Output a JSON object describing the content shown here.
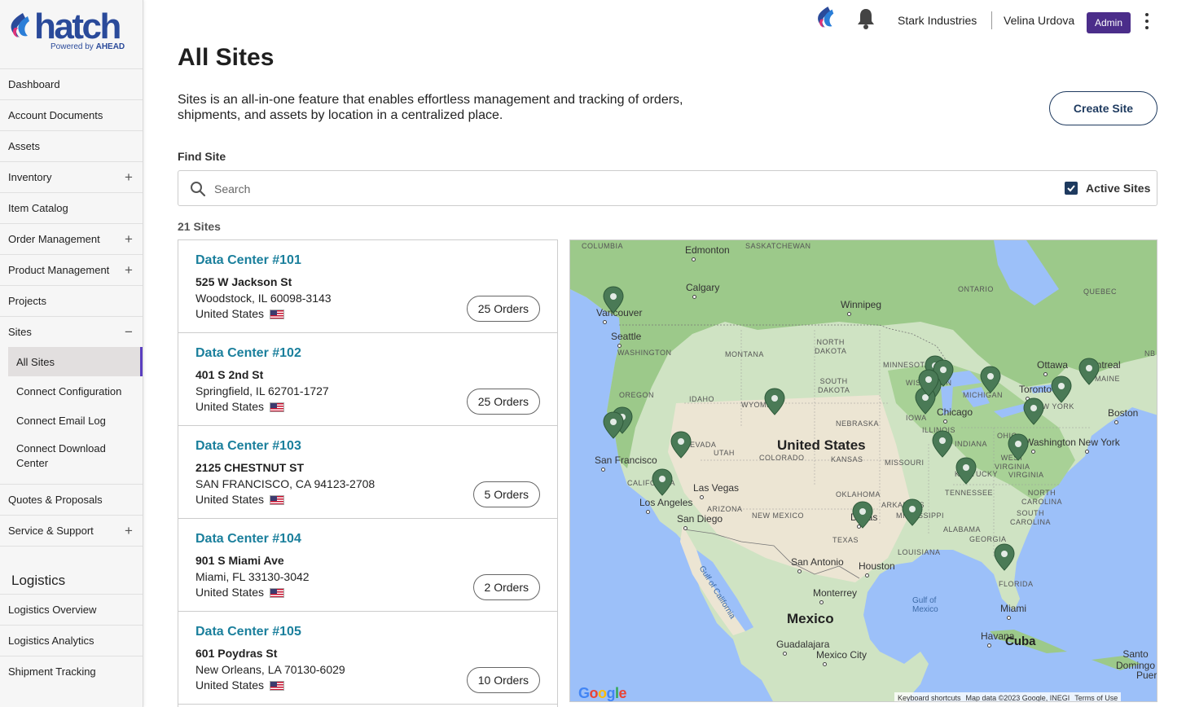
{
  "brand": {
    "name": "hatch",
    "powered_by": "Powered by",
    "powered_company": "AHEAD"
  },
  "sidebar": {
    "items": [
      {
        "label": "Dashboard",
        "expandable": false
      },
      {
        "label": "Account Documents",
        "expandable": false
      },
      {
        "label": "Assets",
        "expandable": false
      },
      {
        "label": "Inventory",
        "expandable": true
      },
      {
        "label": "Item Catalog",
        "expandable": false
      },
      {
        "label": "Order Management",
        "expandable": true
      },
      {
        "label": "Product Management",
        "expandable": true
      },
      {
        "label": "Projects",
        "expandable": false
      },
      {
        "label": "Sites",
        "expanded": true
      }
    ],
    "sites_children": [
      "All Sites",
      "Connect Configuration",
      "Connect Email Log",
      "Connect Download Center"
    ],
    "after_items": [
      {
        "label": "Quotes & Proposals",
        "expandable": false
      },
      {
        "label": "Service & Support",
        "expandable": true
      }
    ],
    "logistics_title": "Logistics",
    "logistics_items": [
      "Logistics Overview",
      "Logistics Analytics",
      "Shipment Tracking"
    ],
    "expand_symbol": "+",
    "collapse_symbol": "−"
  },
  "header": {
    "organization": "Stark Industries",
    "user": "Velina Urdova",
    "role_badge": "Admin",
    "brand_color": "#4b2d8a"
  },
  "page": {
    "title": "All Sites",
    "description": "Sites is an all-in-one feature that enables effortless management and tracking of orders, shipments, and assets by location in a centralized place.",
    "create_button": "Create Site",
    "find_label": "Find Site",
    "search_placeholder": "Search",
    "search_value": "",
    "active_sites_label": "Active Sites",
    "active_sites_checked": true,
    "count_label": "21 Sites"
  },
  "sites": [
    {
      "name": "Data Center #101",
      "street": "525 W Jackson St",
      "city": "Woodstock, IL 60098-3143",
      "country": "United States",
      "orders": "25 Orders"
    },
    {
      "name": "Data Center #102",
      "street": "401 S 2nd St",
      "city": "Springfield, IL 62701-1727",
      "country": "United States",
      "orders": "25 Orders"
    },
    {
      "name": "Data Center #103",
      "street": "2125 CHESTNUT ST",
      "city": "SAN FRANCISCO, CA 94123-2708",
      "country": "United States",
      "orders": "5 Orders"
    },
    {
      "name": "Data Center #104",
      "street": "901 S Miami Ave",
      "city": "Miami, FL 33130-3042",
      "country": "United States",
      "orders": "2 Orders"
    },
    {
      "name": "Data Center #105",
      "street": "601 Poydras St",
      "city": "New Orleans, LA 70130-6029",
      "country": "United States",
      "orders": "10 Orders"
    }
  ],
  "map": {
    "cities": [
      "Edmonton",
      "Calgary",
      "Vancouver",
      "Seattle",
      "Winnipeg",
      "Ottawa",
      "Montreal",
      "Toronto",
      "Boston",
      "New York",
      "Washington",
      "Chicago",
      "Las Vegas",
      "San Francisco",
      "Los Angeles",
      "San Diego",
      "Dallas",
      "Houston",
      "San Antonio",
      "Monterrey",
      "Guadalajara",
      "Mexico City",
      "Miami",
      "Havana"
    ],
    "regions": [
      "COLUMBIA",
      "SASKATCHEWAN",
      "ONTARIO",
      "QUEBEC",
      "WASHINGTON",
      "MONTANA",
      "NORTH DAKOTA",
      "MINNESOTA",
      "OREGON",
      "IDAHO",
      "WYOMING",
      "SOUTH DAKOTA",
      "WISCONSIN",
      "MICHIGAN",
      "MAINE",
      "NB",
      "NEVADA",
      "UTAH",
      "COLORADO",
      "NEBRASKA",
      "IOWA",
      "ILLINOIS",
      "INDIANA",
      "OHIO",
      "NEW YORK",
      "CALIFORNIA",
      "ARIZONA",
      "NEW MEXICO",
      "KANSAS",
      "MISSOURI",
      "KENTUCKY",
      "TENNESSEE",
      "WEST VIRGINIA",
      "VIRGINIA",
      "NORTH CAROLINA",
      "SOUTH CAROLINA",
      "OKLAHOMA",
      "ARKANSAS",
      "MISSISSIPPI",
      "ALABAMA",
      "GEORGIA",
      "TEXAS",
      "LOUISIANA",
      "FLORIDA"
    ],
    "countries": [
      "United States",
      "Mexico",
      "Cuba"
    ],
    "waters": [
      "Gulf of California",
      "Gulf of Mexico"
    ],
    "partial_labels": [
      "Santo Domingo",
      "Puer"
    ],
    "google_letters": [
      "G",
      "o",
      "o",
      "g",
      "l",
      "e"
    ],
    "attribution": [
      "Keyboard shortcuts",
      "Map data ©2023 Google, INEGI",
      "Terms of Use"
    ],
    "pin_color": "#4a7a56",
    "pin_count": 21
  }
}
